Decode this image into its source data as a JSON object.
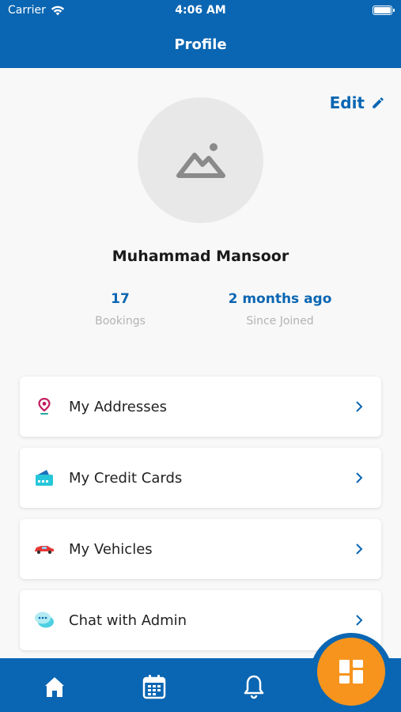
{
  "status_bar": {
    "carrier": "Carrier",
    "time": "4:06 AM"
  },
  "header": {
    "title": "Profile"
  },
  "profile": {
    "edit_label": "Edit",
    "name": "Muhammad Mansoor",
    "stats": [
      {
        "value": "17",
        "label": "Bookings"
      },
      {
        "value": "2 months ago",
        "label": "Since Joined"
      }
    ]
  },
  "menu": [
    {
      "label": "My Addresses",
      "icon": "location-pin-icon"
    },
    {
      "label": "My Credit Cards",
      "icon": "credit-card-icon"
    },
    {
      "label": "My Vehicles",
      "icon": "car-icon"
    },
    {
      "label": "Chat with Admin",
      "icon": "chat-icon"
    }
  ],
  "tab_bar": {
    "items": [
      "home-icon",
      "calendar-icon",
      "bell-icon",
      "dashboard-icon"
    ]
  },
  "colors": {
    "primary": "#0a66b2",
    "accent": "#f7941d"
  }
}
